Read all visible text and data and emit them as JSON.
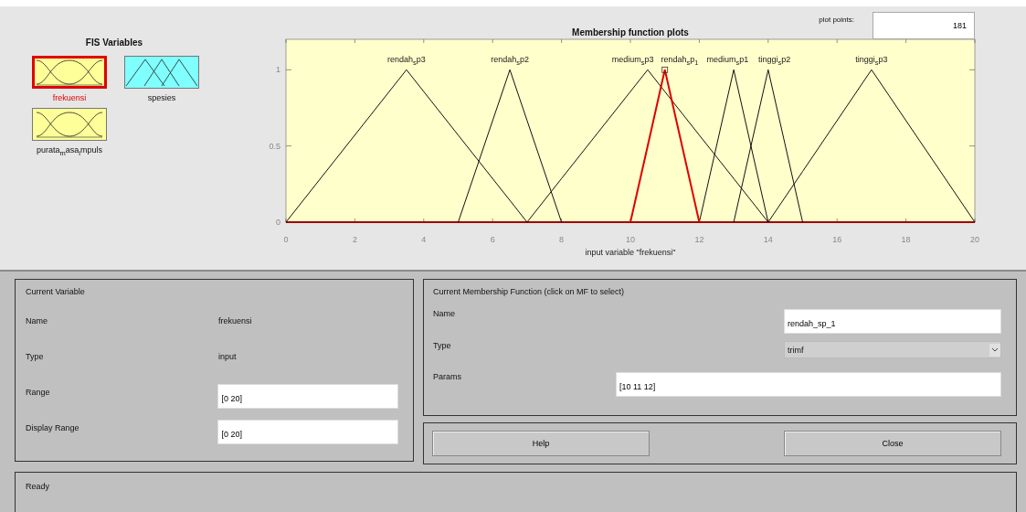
{
  "fis_variables": {
    "title": "FIS Variables",
    "items": [
      {
        "name": "frekuensi",
        "kind": "input",
        "selected": true
      },
      {
        "name": "spesies",
        "kind": "output",
        "selected": false
      },
      {
        "name": "purata$_{m}$asa$_{i}$mpuls",
        "kind": "input",
        "selected": false
      }
    ]
  },
  "plot_points": {
    "label": "plot points:",
    "value": "181"
  },
  "chart": {
    "chart_data": {
      "type": "line",
      "title": "Membership function plots",
      "xlabel": "input variable \"frekuensi\"",
      "x": [
        0,
        3.5,
        5,
        6.5,
        7,
        8,
        10,
        10.5,
        11,
        12,
        13,
        14,
        15,
        17,
        20
      ],
      "xlim": [
        0,
        20
      ],
      "ylim": [
        0,
        1.2
      ],
      "xticks": [
        0,
        2,
        4,
        6,
        8,
        10,
        12,
        14,
        16,
        18,
        20
      ],
      "yticks": [
        0,
        0.5,
        1
      ],
      "series": [
        {
          "name": "rendah$_{s}$p3",
          "values": [
            0,
            1,
            0.571,
            0.143,
            0,
            null,
            null,
            null,
            null,
            null,
            null,
            null,
            null,
            null,
            null
          ]
        },
        {
          "name": "rendah$_{s}$p2",
          "values": [
            null,
            null,
            0,
            1,
            0.667,
            0,
            null,
            null,
            null,
            null,
            null,
            null,
            null,
            null,
            null
          ]
        },
        {
          "name": "medium$_{s}$p3",
          "values": [
            null,
            null,
            null,
            null,
            0,
            0.286,
            0.857,
            1,
            0.857,
            0.571,
            0.286,
            0,
            null,
            null,
            null
          ]
        },
        {
          "name": "medium$_{s}$p1",
          "values": [
            null,
            null,
            null,
            null,
            null,
            null,
            null,
            null,
            null,
            0,
            1,
            0,
            null,
            null,
            null
          ]
        },
        {
          "name": "tinggi$_{s}$p2",
          "values": [
            null,
            null,
            null,
            null,
            null,
            null,
            null,
            null,
            null,
            null,
            0,
            1,
            0,
            null,
            null
          ]
        },
        {
          "name": "tinggi$_{s}$p3",
          "values": [
            null,
            null,
            null,
            null,
            null,
            null,
            null,
            null,
            null,
            null,
            null,
            0,
            0.333,
            1,
            0
          ]
        },
        {
          "name": "rendah$_{s}$p$_{1}$",
          "values": [
            null,
            null,
            null,
            null,
            null,
            null,
            0,
            0.5,
            1,
            0,
            null,
            null,
            null,
            null,
            null
          ]
        }
      ]
    },
    "curves": [
      {
        "selected": false
      },
      {
        "selected": false
      },
      {
        "selected": false
      },
      {
        "selected": false
      },
      {
        "selected": false
      },
      {
        "selected": false
      },
      {
        "selected": true
      }
    ]
  },
  "current_variable": {
    "title": "Current Variable",
    "name_label": "Name",
    "name": "frekuensi",
    "type_label": "Type",
    "type": "input",
    "range_label": "Range",
    "range": "[0 20]",
    "display_range_label": "Display Range",
    "display_range": "[0 20]"
  },
  "current_mf": {
    "title": "Current Membership Function (click on MF to select)",
    "name_label": "Name",
    "name": "rendah_sp_1",
    "type_label": "Type",
    "type": "trimf",
    "params_label": "Params",
    "params": "[10 11 12]"
  },
  "buttons": [
    "Help",
    "Close"
  ],
  "status": "Ready"
}
